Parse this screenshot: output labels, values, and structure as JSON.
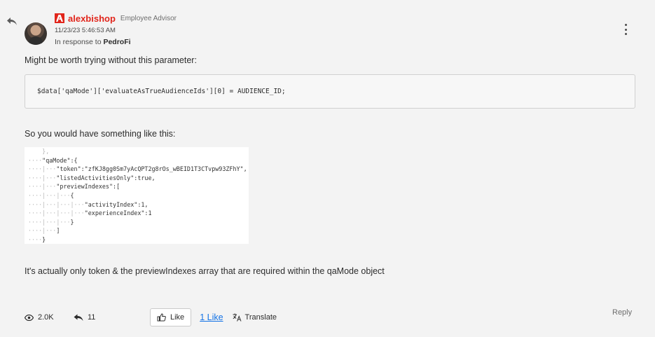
{
  "post": {
    "author": "alexbishop",
    "role": "Employee Advisor",
    "timestamp": "11/23/23  5:46:53 AM",
    "in_response_prefix": "In response to",
    "in_response_user": "PedroFi",
    "paragraph_1": "Might be worth trying without this parameter:",
    "code": "$data['qaMode']['evaluateAsTrueAudienceIds'][0] = AUDIENCE_ID;",
    "paragraph_2": "So you would have something like this:",
    "paragraph_3": "It's actually only token & the previewIndexes array that are required within the qaMode object"
  },
  "footer": {
    "views": "2.0K",
    "replies": "11",
    "like_label": "Like",
    "like_count": "1 Like",
    "translate_label": "Translate",
    "reply_label": "Reply"
  },
  "colors": {
    "accent": "#e1251b",
    "link": "#1473e6",
    "background": "#f3f3f3"
  },
  "icons": {
    "reply": "reply-arrow-icon",
    "logo": "adobe-logo-icon",
    "more": "more-vertical-icon",
    "views": "eye-icon",
    "replies": "reply-arrow-icon",
    "like": "thumbs-up-icon",
    "translate": "translate-icon"
  }
}
